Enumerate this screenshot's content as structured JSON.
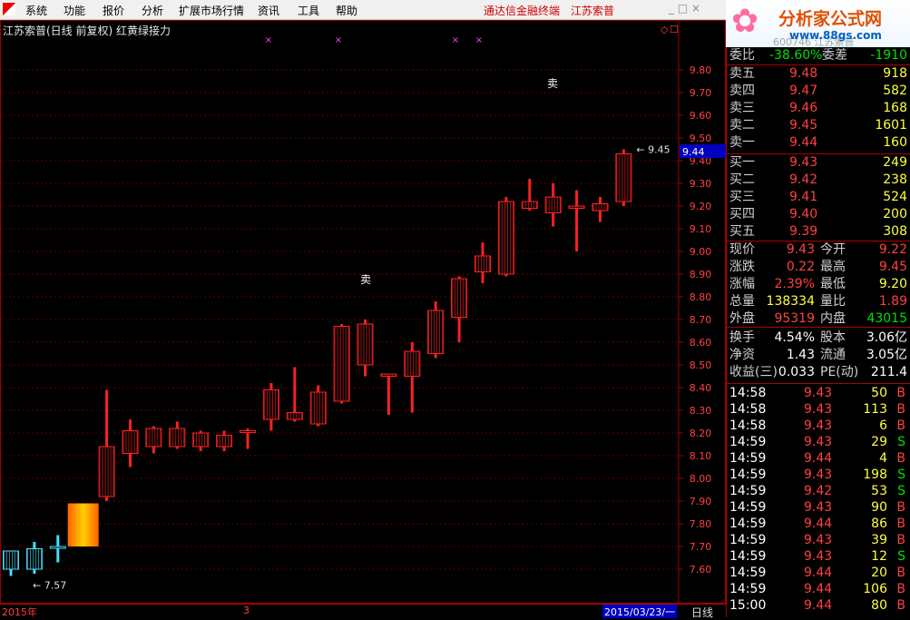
{
  "menubar": {
    "items": [
      "系统",
      "功能",
      "报价",
      "分析",
      "扩展市场行情",
      "资讯",
      "工具",
      "帮助"
    ],
    "brand": "通达信金融终端",
    "stock_name": "江苏索普"
  },
  "chart": {
    "title": "江苏索普(日线 前复权) 红黄绿接力",
    "current_price_label": "9.44",
    "high_label": "9.45",
    "low_label": "7.57",
    "sell_marker": "卖",
    "date_left": "2015年",
    "date_mid": "3",
    "date_right": "2015/03/23/一",
    "period": "日线"
  },
  "chart_data": {
    "type": "candlestick",
    "ylim": [
      7.52,
      9.9
    ],
    "yticks": [
      "9.80",
      "9.70",
      "9.60",
      "9.50",
      "9.40",
      "9.30",
      "9.20",
      "9.10",
      "9.00",
      "8.90",
      "8.80",
      "8.70",
      "8.60",
      "8.50",
      "8.40",
      "8.30",
      "8.20",
      "8.10",
      "8.00",
      "7.90",
      "7.80",
      "7.70",
      "7.60"
    ],
    "candles": [
      {
        "o": 7.6,
        "h": 7.67,
        "l": 7.57,
        "c": 7.68,
        "color": "cyan"
      },
      {
        "o": 7.6,
        "h": 7.72,
        "l": 7.58,
        "c": 7.69,
        "color": "cyan"
      },
      {
        "o": 7.7,
        "h": 7.75,
        "l": 7.63,
        "c": 7.7,
        "color": "cyan"
      },
      {
        "o": 7.7,
        "h": 7.89,
        "l": 7.7,
        "c": 7.89,
        "color": "yellow"
      },
      {
        "o": 7.92,
        "h": 8.39,
        "l": 7.9,
        "c": 8.14,
        "color": "red"
      },
      {
        "o": 8.11,
        "h": 8.26,
        "l": 8.05,
        "c": 8.21,
        "color": "red"
      },
      {
        "o": 8.14,
        "h": 8.23,
        "l": 8.11,
        "c": 8.22,
        "color": "red"
      },
      {
        "o": 8.14,
        "h": 8.25,
        "l": 8.13,
        "c": 8.22,
        "color": "red"
      },
      {
        "o": 8.14,
        "h": 8.21,
        "l": 8.12,
        "c": 8.2,
        "color": "red"
      },
      {
        "o": 8.14,
        "h": 8.21,
        "l": 8.12,
        "c": 8.19,
        "color": "red"
      },
      {
        "o": 8.21,
        "h": 8.22,
        "l": 8.13,
        "c": 8.21,
        "color": "red"
      },
      {
        "o": 8.26,
        "h": 8.42,
        "l": 8.21,
        "c": 8.39,
        "color": "red"
      },
      {
        "o": 8.26,
        "h": 8.49,
        "l": 8.25,
        "c": 8.29,
        "color": "red"
      },
      {
        "o": 8.24,
        "h": 8.41,
        "l": 8.23,
        "c": 8.38,
        "color": "red"
      },
      {
        "o": 8.34,
        "h": 8.68,
        "l": 8.33,
        "c": 8.67,
        "color": "red"
      },
      {
        "o": 8.5,
        "h": 8.7,
        "l": 8.45,
        "c": 8.68,
        "color": "red"
      },
      {
        "o": 8.45,
        "h": 8.46,
        "l": 8.28,
        "c": 8.46,
        "color": "red"
      },
      {
        "o": 8.45,
        "h": 8.6,
        "l": 8.29,
        "c": 8.56,
        "color": "red"
      },
      {
        "o": 8.55,
        "h": 8.78,
        "l": 8.53,
        "c": 8.74,
        "color": "red"
      },
      {
        "o": 8.71,
        "h": 8.89,
        "l": 8.6,
        "c": 8.88,
        "color": "red"
      },
      {
        "o": 8.91,
        "h": 9.04,
        "l": 8.86,
        "c": 8.98,
        "color": "red"
      },
      {
        "o": 8.9,
        "h": 9.24,
        "l": 8.89,
        "c": 9.22,
        "color": "red"
      },
      {
        "o": 9.19,
        "h": 9.32,
        "l": 9.18,
        "c": 9.22,
        "color": "red"
      },
      {
        "o": 9.17,
        "h": 9.3,
        "l": 9.11,
        "c": 9.24,
        "color": "red"
      },
      {
        "o": 9.19,
        "h": 9.27,
        "l": 9.0,
        "c": 9.2,
        "color": "red"
      },
      {
        "o": 9.18,
        "h": 9.24,
        "l": 9.13,
        "c": 9.21,
        "color": "red"
      },
      {
        "o": 9.22,
        "h": 9.45,
        "l": 9.2,
        "c": 9.43,
        "color": "red"
      }
    ]
  },
  "panel": {
    "wei_bi_label": "委比",
    "wei_bi": "-38.60%",
    "wei_cha_label": "委差",
    "wei_cha": "-1910",
    "sells": [
      {
        "label": "卖五",
        "price": "9.48",
        "vol": "918"
      },
      {
        "label": "卖四",
        "price": "9.47",
        "vol": "582"
      },
      {
        "label": "卖三",
        "price": "9.46",
        "vol": "168"
      },
      {
        "label": "卖二",
        "price": "9.45",
        "vol": "1601"
      },
      {
        "label": "卖一",
        "price": "9.44",
        "vol": "160"
      }
    ],
    "buys": [
      {
        "label": "买一",
        "price": "9.43",
        "vol": "249"
      },
      {
        "label": "买二",
        "price": "9.42",
        "vol": "238"
      },
      {
        "label": "买三",
        "price": "9.41",
        "vol": "524"
      },
      {
        "label": "买四",
        "price": "9.40",
        "vol": "200"
      },
      {
        "label": "买五",
        "price": "9.39",
        "vol": "308"
      }
    ],
    "stats": [
      {
        "l1": "现价",
        "v1": "9.43",
        "c1": "red",
        "l2": "今开",
        "v2": "9.22",
        "c2": "red"
      },
      {
        "l1": "涨跌",
        "v1": "0.22",
        "c1": "red",
        "l2": "最高",
        "v2": "9.45",
        "c2": "red"
      },
      {
        "l1": "涨幅",
        "v1": "2.39%",
        "c1": "red",
        "l2": "最低",
        "v2": "9.20",
        "c2": "yel"
      },
      {
        "l1": "总量",
        "v1": "138334",
        "c1": "yel",
        "l2": "量比",
        "v2": "1.89",
        "c2": "red"
      },
      {
        "l1": "外盘",
        "v1": "95319",
        "c1": "red",
        "l2": "内盘",
        "v2": "43015",
        "c2": "green"
      }
    ],
    "stats2": [
      {
        "l1": "换手",
        "v1": "4.54%",
        "l2": "股本",
        "v2": "3.06亿"
      },
      {
        "l1": "净资",
        "v1": "1.43",
        "l2": "流通",
        "v2": "3.05亿"
      },
      {
        "l1": "收益(三)",
        "v1": "0.033",
        "l2": "PE(动)",
        "v2": "211.4"
      }
    ],
    "ticks": [
      {
        "t": "14:58",
        "p": "9.43",
        "v": "50",
        "s": "B"
      },
      {
        "t": "14:58",
        "p": "9.43",
        "v": "113",
        "s": "B"
      },
      {
        "t": "14:58",
        "p": "9.43",
        "v": "6",
        "s": "B"
      },
      {
        "t": "14:59",
        "p": "9.43",
        "v": "29",
        "s": "S"
      },
      {
        "t": "14:59",
        "p": "9.44",
        "v": "4",
        "s": "B"
      },
      {
        "t": "14:59",
        "p": "9.43",
        "v": "198",
        "s": "S"
      },
      {
        "t": "14:59",
        "p": "9.42",
        "v": "53",
        "s": "S"
      },
      {
        "t": "14:59",
        "p": "9.43",
        "v": "90",
        "s": "B"
      },
      {
        "t": "14:59",
        "p": "9.44",
        "v": "86",
        "s": "B"
      },
      {
        "t": "14:59",
        "p": "9.43",
        "v": "39",
        "s": "B"
      },
      {
        "t": "14:59",
        "p": "9.43",
        "v": "12",
        "s": "S"
      },
      {
        "t": "14:59",
        "p": "9.44",
        "v": "20",
        "s": "B"
      },
      {
        "t": "14:59",
        "p": "9.44",
        "v": "106",
        "s": "B"
      },
      {
        "t": "15:00",
        "p": "9.44",
        "v": "80",
        "s": "B"
      }
    ]
  },
  "logo": {
    "title": "分析家公式网",
    "url": "www.88gs.com",
    "faded": "600746 江苏索普"
  },
  "colors": {
    "up": "#ff2020",
    "down": "#00e0e0",
    "grid": "#a00000",
    "bg": "#000000"
  }
}
